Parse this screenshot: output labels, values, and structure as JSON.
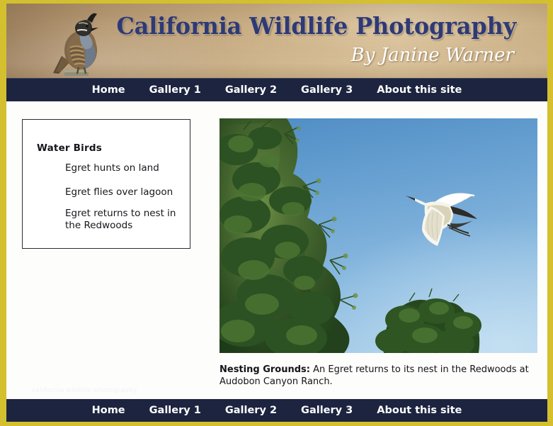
{
  "site": {
    "title": "California Wildlife Photography",
    "byline": "By Janine Warner",
    "banner_bird_icon": "california-quail-icon",
    "frame_color": "#d4c02f",
    "nav_color": "#1d2440",
    "title_color": "#2e3a76",
    "banner_sand_color": "#cdb288"
  },
  "nav": {
    "items": [
      {
        "label": "Home"
      },
      {
        "label": "Gallery 1"
      },
      {
        "label": "Gallery 2"
      },
      {
        "label": "Gallery 3"
      },
      {
        "label": "About this site"
      }
    ]
  },
  "sidebar": {
    "heading": "Water Birds",
    "links": [
      {
        "label": "Egret hunts on land"
      },
      {
        "label": "Egret flies over lagoon"
      },
      {
        "label": "Egret returns to nest in the Redwoods"
      }
    ]
  },
  "main": {
    "photo_alt": "egret-in-flight-photo",
    "caption_label": "Nesting Grounds:",
    "caption_text": " An Egret returns to its nest in the Redwoods at Audobon Canyon Ranch."
  },
  "footer": {
    "watermark": "california wildlife photography"
  }
}
